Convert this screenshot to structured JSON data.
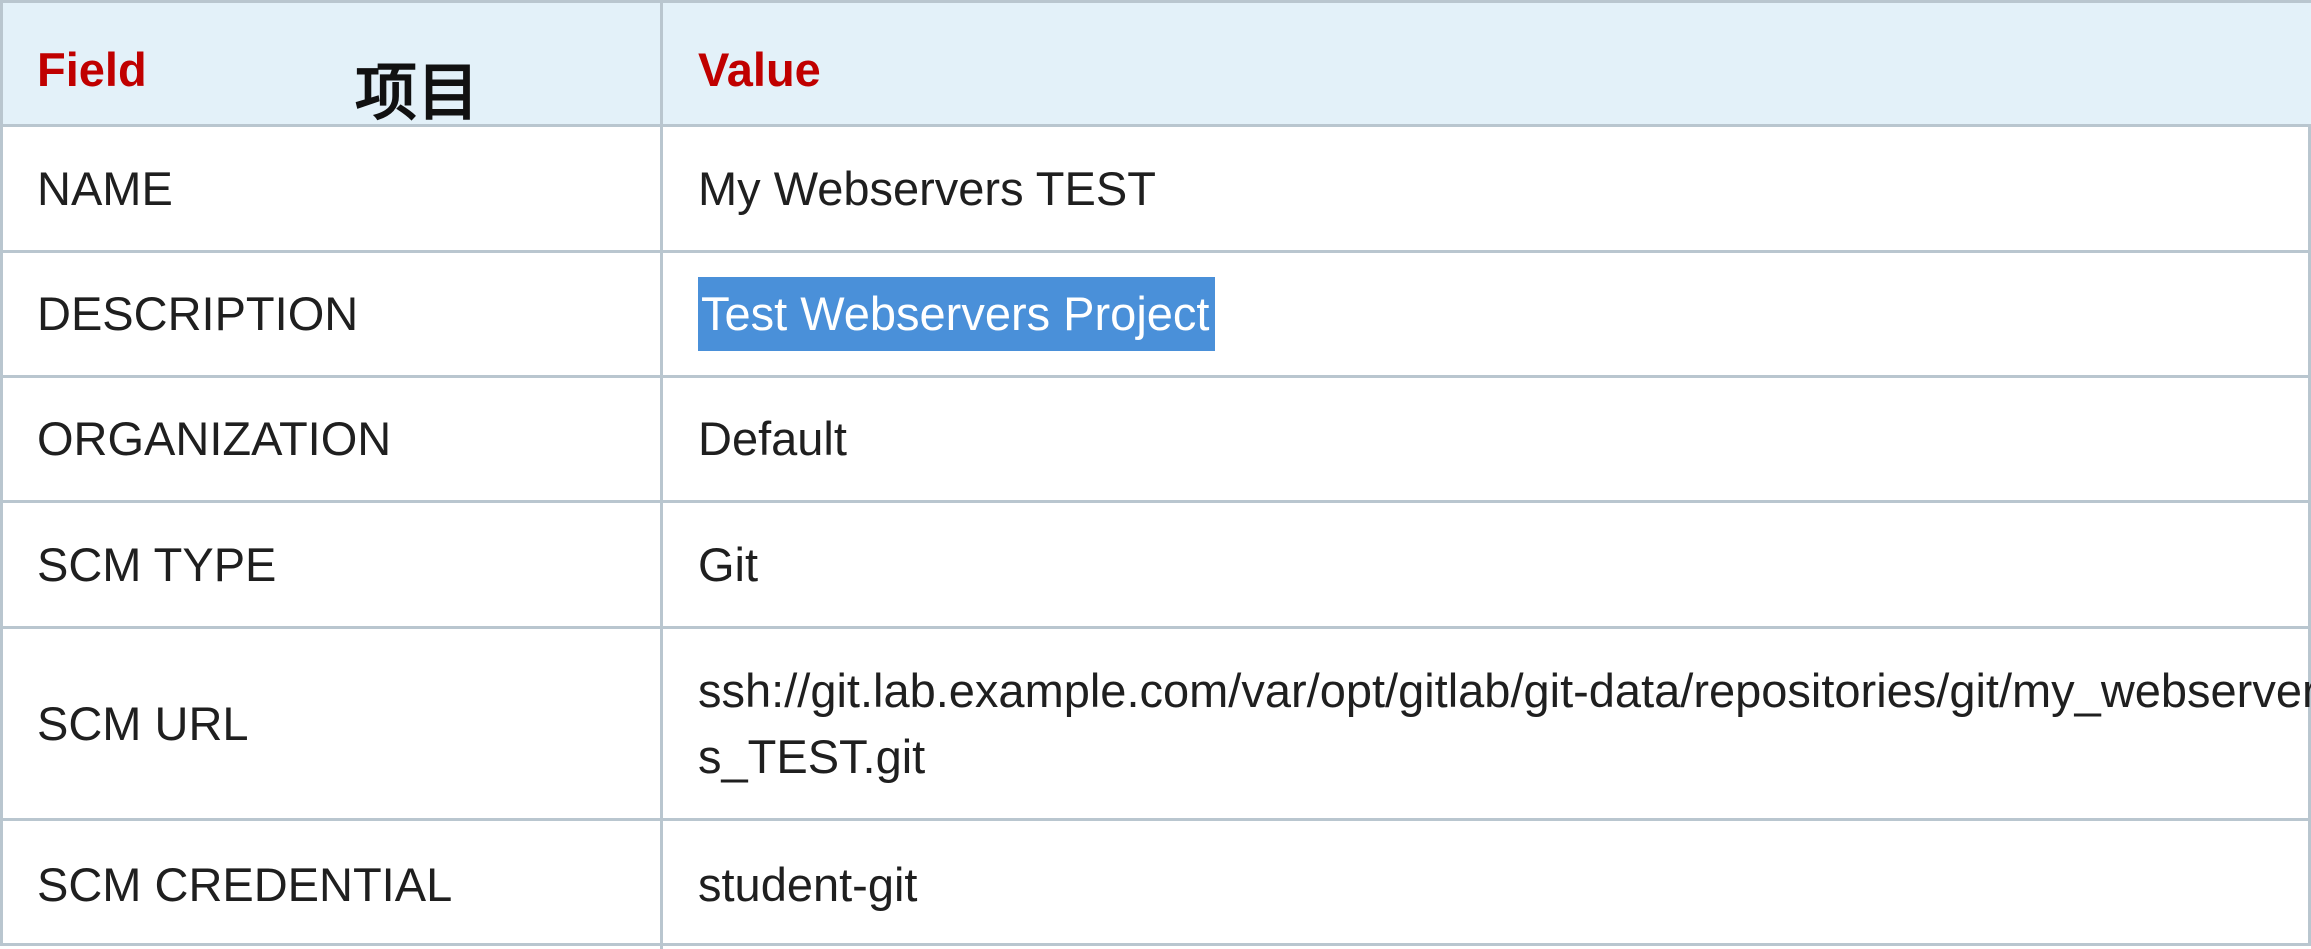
{
  "header": {
    "field": "Field",
    "value": "Value",
    "annotation": "项目"
  },
  "rows": [
    {
      "field": "NAME",
      "value": "My Webservers TEST"
    },
    {
      "field": "DESCRIPTION",
      "value": "Test Webservers Project"
    },
    {
      "field": "ORGANIZATION",
      "value": "Default"
    },
    {
      "field": "SCM TYPE",
      "value": "Git"
    },
    {
      "field": "SCM URL",
      "value": "ssh://git.lab.example.com/var/opt/gitlab/git-data/repositories/git/my_webservers_TEST.git"
    },
    {
      "field": "SCM CREDENTIAL",
      "value": "student-git"
    }
  ],
  "colors": {
    "header_bg": "#e3f1f9",
    "header_text": "#c00000",
    "border": "#b9c6cf",
    "selection": "#4a90d9"
  }
}
